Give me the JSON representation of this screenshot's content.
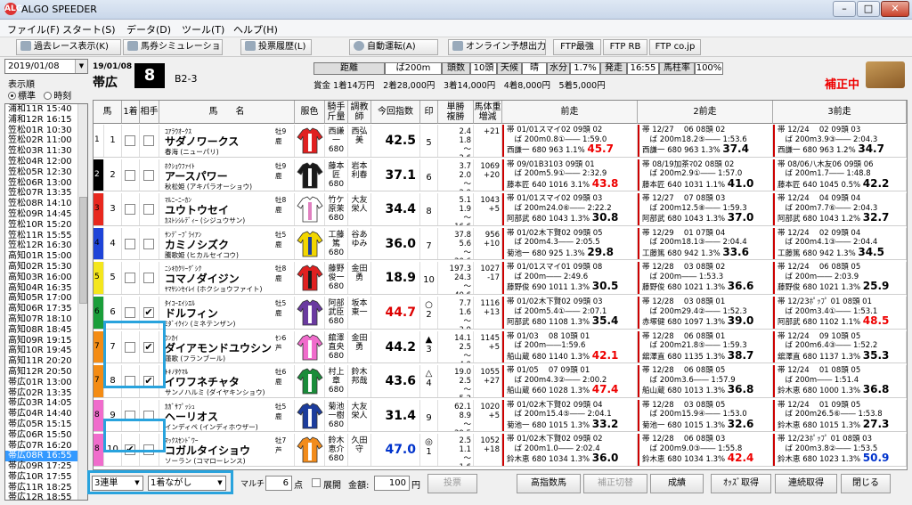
{
  "window": {
    "title": "ALGO SPEEDER",
    "app_icon": "ALG"
  },
  "menu": [
    "ファイル(F)",
    "スタート(S)",
    "データ(D)",
    "ツール(T)",
    "ヘルプ(H)"
  ],
  "toolbar": [
    "過去レース表示(K)",
    "馬券シミュレーション(B)",
    "投票履歴(L)",
    "自動運転(A)",
    "オンライン予想出力",
    "FTP最強",
    "FTP RB",
    "FTP co.jp"
  ],
  "left": {
    "date": "2019/01/08",
    "order_label": "表示順",
    "radio_standard": "標準",
    "radio_time": "時刻",
    "races": [
      "浦和11R 15:40",
      "浦和12R 16:15",
      "笠松01R 10:30",
      "笠松02R 11:00",
      "笠松03R 11:30",
      "笠松04R 12:00",
      "笠松05R 12:30",
      "笠松06R 13:00",
      "笠松07R 13:35",
      "笠松08R 14:10",
      "笠松09R 14:45",
      "笠松10R 15:20",
      "笠松11R 15:55",
      "笠松12R 16:30",
      "高知01R 15:00",
      "高知02R 15:30",
      "高知03R 16:00",
      "高知04R 16:35",
      "高知05R 17:00",
      "高知06R 17:35",
      "高知07R 18:10",
      "高知08R 18:45",
      "高知09R 19:15",
      "高知10R 19:45",
      "高知11R 20:20",
      "高知12R 20:50",
      "帯広01R 13:00",
      "帯広02R 13:35",
      "帯広03R 14:05",
      "帯広04R 14:40",
      "帯広05R 15:15",
      "帯広06R 15:50",
      "帯広07R 16:20",
      "帯広08R 16:55",
      "帯広09R 17:25",
      "帯広10R 17:55",
      "帯広11R 18:25",
      "帯広12R 18:55"
    ],
    "selected": "帯広08R 16:55"
  },
  "race": {
    "date": "19/01/08",
    "venue": "帯広",
    "number": "8",
    "class": "B2-3",
    "info": [
      [
        "距離",
        ""
      ],
      [
        "ば200m",
        ""
      ],
      [
        "頭数",
        ""
      ],
      [
        "10頭",
        ""
      ],
      [
        "天候",
        ""
      ],
      [
        "晴",
        ""
      ],
      [
        "水分",
        ""
      ],
      [
        "1.7%",
        ""
      ],
      [
        "発走",
        ""
      ],
      [
        "16:55",
        ""
      ],
      [
        "馬柱率",
        ""
      ],
      [
        "100%",
        ""
      ]
    ],
    "prize": "賞金 1着14万円　2着28,000円　3着14,000円　4着8,000円　5着5,000円",
    "status": "補正中"
  },
  "columns": [
    "馬",
    "1着",
    "相手",
    "馬　　名",
    "服色",
    "騎手\n斤量",
    "調教\n師",
    "今回指数",
    "印",
    "単勝\n複勝",
    "馬体重\n増減",
    "前走",
    "2前走",
    "3前走"
  ],
  "horses": [
    {
      "waku": "1",
      "num": "1",
      "c1": "",
      "c2": "",
      "sire": "ｺｱﾗｳｵｰｸｽ",
      "sex": "牡9 鹿",
      "name": "サダノワークス",
      "dam": "春海 (ニューパリ)",
      "jockey": "西謙一\n680",
      "trainer": "西弘美",
      "index": "42.5",
      "idxcolor": "#000",
      "mark": "\n5",
      "odds": "2.4\n1.8\n～\n2.6",
      "wt": "",
      "wt2": "+21",
      "p1": "帯 01/01スマイ02 09頭 02\n　ば 200m0.8①―― 1:59.0\n西謙一 680 963 1.1%",
      "p1v": "45.7",
      "p1c": "red",
      "p2": "帯 12/27　 06 08頭 02\n　ば 200m18.2⑤―― 1:53.6\n西謙一 680 963 1.3%",
      "p2v": "37.4",
      "p2c": "",
      "p3": "帯 12/24　 02 09頭 03\n　ば 200m3.9③―― 2:04.3\n西謙一 680 963 1.2%",
      "p3v": "34.7",
      "p3c": ""
    },
    {
      "waku": "2",
      "num": "2",
      "c1": "",
      "c2": "",
      "sire": "ﾎｸｼｮｳﾌｧｲﾄ",
      "sex": "牡9 鹿",
      "name": "アースパワー",
      "dam": "秋松姫 (アキパラオーショウ)",
      "jockey": "藤本匠\n680",
      "trainer": "岩本利春",
      "index": "37.1",
      "idxcolor": "#000",
      "mark": "\n6",
      "odds": "3.7\n2.0\n～\n2.9",
      "wt": "1069",
      "wt2": "+20",
      "p1": "帯 09/01B3103 09頭 01\n　ば 200m5.9①―― 2:32.9\n藤本匠 640 1016 3.1%",
      "p1v": "43.8",
      "p1c": "red",
      "p2": "帯 08/19加茶ﾏ02 08頭 02\n　ば 200m2.9①―― 1:57.0\n藤本匠 640 1031 1.1%",
      "p2v": "41.0",
      "p2c": "",
      "p3": "帯 08/06八木友06 09頭 06\n　ば 200m1.7―― 1:48.8\n藤本匠 640 1045 0.5%",
      "p3v": "42.2",
      "p3c": ""
    },
    {
      "waku": "3",
      "num": "3",
      "c1": "",
      "c2": "",
      "sire": "ﾏﾙﾆｰﾆｰｶﾝ",
      "sex": "牡8 鹿",
      "name": "ユウトウセイ",
      "dam": "ｶｽﾄｼｼﾚﾃﾞｨｰ (シジュウサン)",
      "jockey": "竹ケ原茉\n680",
      "trainer": "大友栄人",
      "index": "34.4",
      "idxcolor": "#000",
      "mark": "\n8",
      "odds": "5.1\n1.9\n～\n16.6",
      "wt": "1043",
      "wt2": "+5",
      "p1": "帯 01/01スマイ02 09頭 03\n　ば 200m24.0⑥―― 2:22.2\n阿部武 680 1043 1.3%",
      "p1v": "30.8",
      "p1c": "",
      "p2": "帯 12/27　 07 08頭 03\n　ば 200m12.5⑧―― 1:59.3\n阿部武 680 1043 1.3%",
      "p2v": "37.0",
      "p2c": "",
      "p3": "帯 12/24　 04 09頭 04\n　ば 200m7.7⑥―― 2:04.3\n阿部武 680 1043 1.2%",
      "p3v": "32.7",
      "p3c": ""
    },
    {
      "waku": "4",
      "num": "4",
      "c1": "",
      "c2": "",
      "sire": "ｻﾝﾃﾞｰﾌﾞﾗｲｱﾝ",
      "sex": "牡5 鹿",
      "name": "カミノシズク",
      "dam": "騰歌姫 (ヒカルセイコウ)",
      "jockey": "工藤篤\n680",
      "trainer": "谷あゆみ",
      "index": "36.0",
      "idxcolor": "#000",
      "mark": "\n7",
      "odds": "37.8\n5.6\n～\n20.6",
      "wt": "956",
      "wt2": "+10",
      "p1": "帯 01/02木下賢02 09頭 05\n　ば 200m4.3―― 2:05.5\n菊池一 680 925 1.3%",
      "p1v": "29.8",
      "p1c": "",
      "p2": "帯 12/29　 01 07頭 04\n　ば 200m18.1③―― 2:04.4\n工藤篤 680 942 1.3%",
      "p2v": "33.6",
      "p2c": "",
      "p3": "帯 12/24　 02 09頭 04\n　ば 200m4.1③―― 2:04.4\n工藤篤 680 942 1.3%",
      "p3v": "34.5",
      "p3c": ""
    },
    {
      "waku": "5",
      "num": "5",
      "c1": "",
      "c2": "",
      "sire": "ﾆｼｷｶｸﾘｰｸﾞｼｸ",
      "sex": "牡8 鹿",
      "name": "コマノダイジン",
      "dam": "ﾔﾏｻｼﾝｾｲﾚｲ (ホクショウファイト)",
      "jockey": "藤野俊一\n680",
      "trainer": "金田勇",
      "index": "18.9",
      "idxcolor": "#000",
      "mark": "\n10",
      "odds": "197.3\n24.3\n～\n40.6",
      "wt": "1027",
      "wt2": "-17",
      "p1": "帯 01/01スマイ01 09頭 08\n　ば 200m―― 2:49.6\n藤野俊 690 1011 1.3%",
      "p1v": "30.5",
      "p1c": "",
      "p2": "帯 12/28　 03 08頭 02\n　ば 200m―― 1:53.3\n藤野俊 680 1021 1.3%",
      "p2v": "36.6",
      "p2c": "",
      "p3": "帯 12/24　 06 08頭 05\n　ば 200m―― 2:03.9\n藤野俊 680 1021 1.3%",
      "p3v": "25.9",
      "p3c": ""
    },
    {
      "waku": "6",
      "num": "6",
      "c1": "",
      "c2": "✔",
      "sire": "ﾀｲｺｰｴｲｼｴﾙ",
      "sex": "牡5 鹿",
      "name": "ドルフィン",
      "dam": "ﾐﾀﾞｲｸｲﾝ (ミネテンザン)",
      "jockey": "阿部武臣\n680",
      "trainer": "坂本東一",
      "index": "44.7",
      "idxcolor": "#d00",
      "mark": "○\n2",
      "odds": "7.7\n1.6\n～\n3.9",
      "wt": "1116",
      "wt2": "+13",
      "p1": "帯 01/02木下賢02 09頭 03\n　ば 200m5.4①―― 2:07.1\n阿部武 680 1108 1.3%",
      "p1v": "35.4",
      "p1c": "",
      "p2": "帯 12/28　 03 08頭 01\n　ば 200m29.4②―― 1:52.3\n赤塚健 680 1097 1.3%",
      "p2v": "39.0",
      "p2c": "",
      "p3": "帯 12/23ﾎﾟｯﾌﾟ 01 08頭 01\n　ば 200m3.4①―― 1:53.1\n阿部武 680 1102 1.1%",
      "p3v": "48.5",
      "p3c": "red"
    },
    {
      "waku": "7",
      "num": "7",
      "c1": "",
      "c2": "✔",
      "sire": "ｳﾝｶｲ",
      "sex": "ｾﾝ6 芦",
      "name": "ダイアモンドユウシン",
      "dam": "蓮歌 (フランブール)",
      "jockey": "舘澤直央\n680",
      "trainer": "金田勇",
      "index": "44.2",
      "idxcolor": "#000",
      "mark": "▲\n3",
      "odds": "14.1\n2.5\n～\n4.9",
      "wt": "1145",
      "wt2": "+5",
      "p1": "帯 01/03　 08 10頭 01\n　ば 200m――1:59.6\n船山蔵 680 1140 1.3%",
      "p1v": "42.1",
      "p1c": "red",
      "p2": "帯 12/28　 06 08頭 01\n　ば 200m21.8⑤―― 1:59.3\n舘澤直 680 1135 1.3%",
      "p2v": "38.7",
      "p2c": "",
      "p3": "帯 12/24　 09 10頭 05\n　ば 200m6.4③―― 1:52.2\n舘澤直 680 1137 1.3%",
      "p3v": "35.3",
      "p3c": ""
    },
    {
      "waku": "7",
      "num": "8",
      "c1": "",
      "c2": "✔",
      "sire": "ﾄｷﾉﾀｹﾏﾙ",
      "sex": "牡6 鹿",
      "name": "イワフネチャタ",
      "dam": "サンノハルミ (ダイヤキンショウ)",
      "jockey": "村上章\n680",
      "trainer": "鈴木邦哉",
      "index": "43.6",
      "idxcolor": "#000",
      "mark": "△\n4",
      "odds": "19.0\n2.5\n～\n5.2",
      "wt": "1055",
      "wt2": "+27",
      "p1": "帯 01/05　 07 09頭 01\n　ば 200m4.3②―― 2:00.2\n船山蔵 660 1028 1.3%",
      "p1v": "47.4",
      "p1c": "red",
      "p2": "帯 12/28　 06 08頭 05\n　ば 200m3.6―― 1:57.9\n船山蔵 680 1013 1.3%",
      "p2v": "36.8",
      "p2c": "",
      "p3": "帯 12/24　 01 08頭 05\n　ば 200m―― 1:51.4\n鈴木恵 680 1000 1.3%",
      "p3v": "36.8",
      "p3c": ""
    },
    {
      "waku": "8",
      "num": "9",
      "c1": "",
      "c2": "",
      "sire": "ｶｶﾞｻﾌﾟｯｼｭ",
      "sex": "牡5 鹿",
      "name": "ヘーリオス",
      "dam": "インディペ (インディホウザー)",
      "jockey": "菊池一樹\n680",
      "trainer": "大友栄人",
      "index": "31.4",
      "idxcolor": "#000",
      "mark": "\n9",
      "odds": "62.1\n8.9\n～\n29.5",
      "wt": "1020",
      "wt2": "+5",
      "p1": "帯 01/02木下賢02 09頭 04\n　ば 200m15.4⑤―― 2:04.1\n菊池一 680 1015 1.3%",
      "p1v": "33.2",
      "p1c": "",
      "p2": "帯 12/28　 03 08頭 05\n　ば 200m15.9④―― 1:53.0\n菊池一 680 1015 1.3%",
      "p2v": "32.6",
      "p2c": "",
      "p3": "帯 12/24　 01 09頭 05\n　ば 200m26.5⑥―― 1:53.8\n鈴木恵 680 1015 1.3%",
      "p3v": "27.3",
      "p3c": ""
    },
    {
      "waku": "8",
      "num": "10",
      "c1": "✔",
      "c2": "",
      "sire": "ﾏｯｸｽｾﾝﾄﾞﾜｰ",
      "sex": "牡7 芦",
      "name": "コガルタイショウ",
      "dam": "ソーラン (コマローレンス)",
      "jockey": "鈴木恵介\n680",
      "trainer": "久田守",
      "index": "47.0",
      "idxcolor": "#0033cc",
      "mark": "◎\n1",
      "odds": "2.5\n1.1\n～\n1.6",
      "wt": "1052",
      "wt2": "+18",
      "p1": "帯 01/02木下賢02 09頭 02\n　ば 200m1.0―― 2:02.4\n鈴木恵 680 1034 1.3%",
      "p1v": "36.0",
      "p1c": "",
      "p2": "帯 12/28　 06 08頭 03\n　ば 200m9.0③―― 1:55.8\n鈴木恵 680 1034 1.3%",
      "p2v": "42.4",
      "p2c": "red",
      "p3": "帯 12/23ﾎﾟｯﾌﾟ 01 08頭 03\n　ば 200m3.8②―― 1:53.5\n鈴木恵 680 1023 1.3%",
      "p3v": "50.9",
      "p3c": "blue"
    }
  ],
  "bottom": {
    "bet_type": "3連単",
    "bet_mode": "1着ながし",
    "multi": "マルチ",
    "points": "6",
    "points_unit": "点",
    "spread": "展開",
    "amount_label": "金額:",
    "amount": "100",
    "amount_unit": "円",
    "vote": "投票",
    "btns": [
      "高指数馬",
      "補正切替",
      "成績",
      "ｵｯｽﾞ取得",
      "連続取得",
      "閉じる"
    ]
  },
  "colors": {
    "waku": [
      "#ffffff",
      "#000000",
      "#e8281e",
      "#1e44d8",
      "#f4e61c",
      "#1a9e3a",
      "#f48c14",
      "#f06ccc"
    ],
    "accent": "#29a3dd"
  }
}
